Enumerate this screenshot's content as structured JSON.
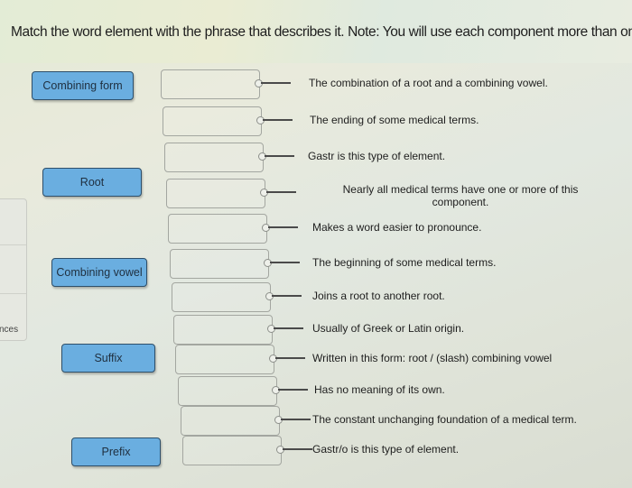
{
  "instructions": "Match the word element with the phrase that describes it. Note: You will use each component more than once.",
  "side_panel": {
    "label": "nces"
  },
  "terms": [
    {
      "label": "Combining form"
    },
    {
      "label": "Root"
    },
    {
      "label": "Combining vowel"
    },
    {
      "label": "Suffix"
    },
    {
      "label": "Prefix"
    }
  ],
  "phrases": [
    {
      "text": "The combination of a root and a combining vowel.",
      "answer": ""
    },
    {
      "text": "The ending of some medical terms.",
      "answer": ""
    },
    {
      "text": "Gastr is this type of element.",
      "answer": ""
    },
    {
      "text": "Nearly all medical terms have one or more of this component.",
      "answer": ""
    },
    {
      "text": "Makes a word easier to pronounce.",
      "answer": ""
    },
    {
      "text": "The beginning of some medical terms.",
      "answer": ""
    },
    {
      "text": "Joins a root to another root.",
      "answer": ""
    },
    {
      "text": "Usually of Greek or Latin origin.",
      "answer": ""
    },
    {
      "text": "Written in this form: root / (slash) combining vowel",
      "answer": ""
    },
    {
      "text": "Has no meaning of its own.",
      "answer": ""
    },
    {
      "text": "The constant unchanging foundation of a medical term.",
      "answer": ""
    },
    {
      "text": "Gastr/o is this type of element.",
      "answer": ""
    }
  ]
}
